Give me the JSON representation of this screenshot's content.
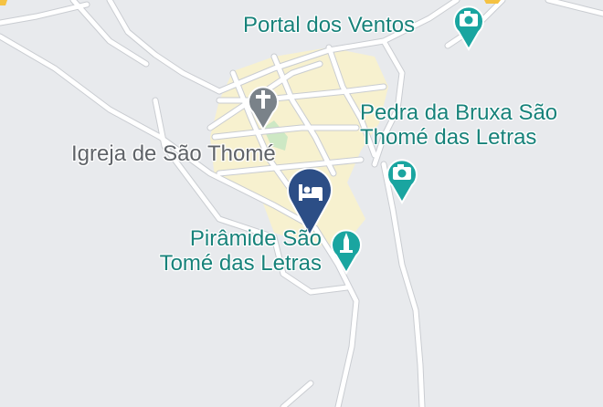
{
  "map": {
    "colors": {
      "background": "#e8eaed",
      "road": "#ffffff",
      "road_outline": "#c9ccd1",
      "urban_area": "#f7f1cf",
      "park": "#cde8c4",
      "poi_teal": "#17827a",
      "poi_gray": "#5f6368",
      "hotel_marker": "#2c4e86"
    },
    "places": [
      {
        "id": "portal",
        "name": "Portal dos Ventos",
        "icon": "camera-icon",
        "color": "#17827a"
      },
      {
        "id": "pedra",
        "line1": "Pedra da Bruxa São",
        "line2": "Thomé das Letras",
        "icon": "camera-icon",
        "color": "#17827a"
      },
      {
        "id": "igreja",
        "name": "Igreja de São Thomé",
        "icon": "cross-icon",
        "color": "#5f6368"
      },
      {
        "id": "piramide",
        "line1": "Pirâmide São",
        "line2": "Tomé das Letras",
        "icon": "monument-icon",
        "color": "#17827a"
      }
    ],
    "hotel_marker": {
      "icon": "bed-icon",
      "color": "#2c4e86"
    }
  }
}
